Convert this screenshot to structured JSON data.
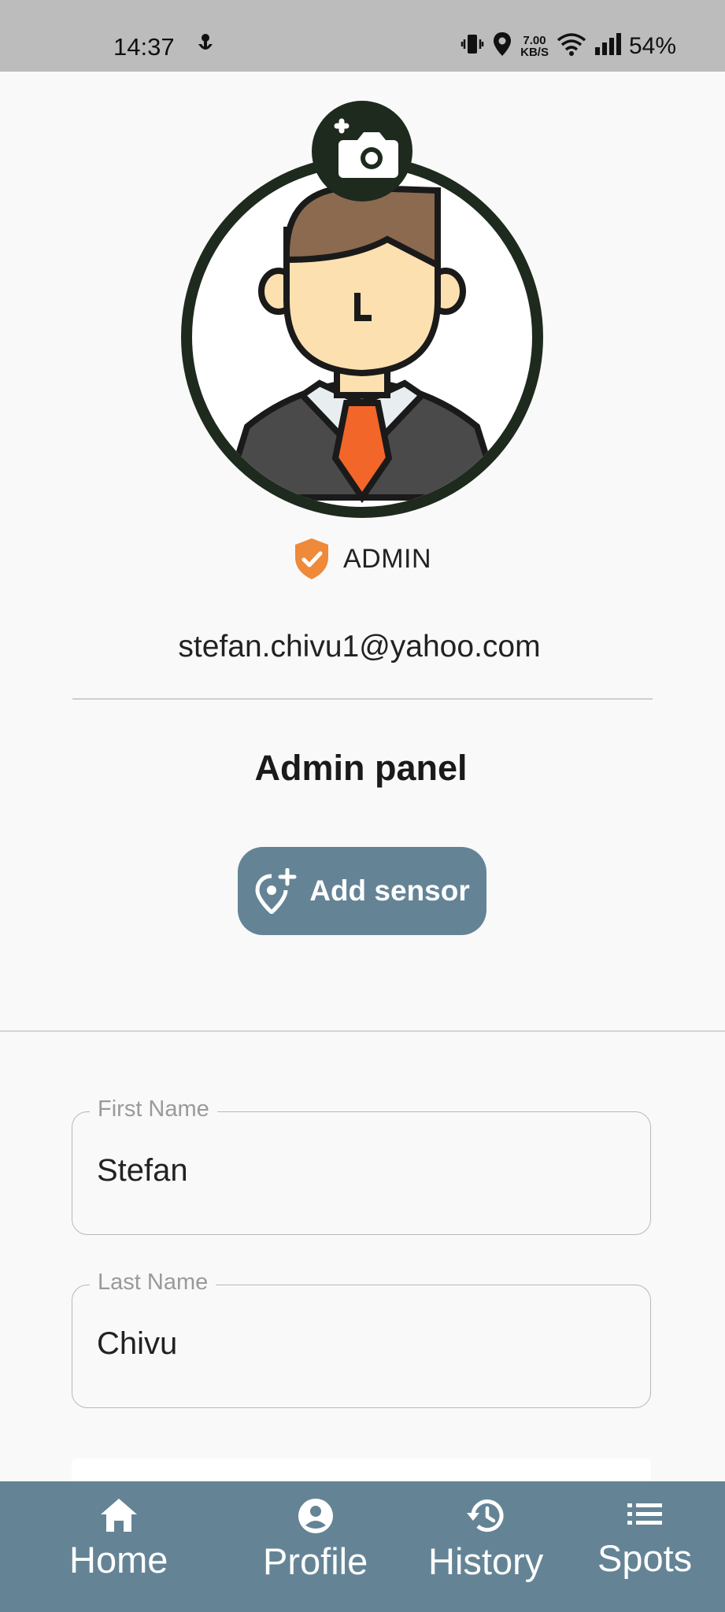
{
  "status_bar": {
    "time": "14:37",
    "speed_value": "7.00",
    "speed_unit": "KB/S",
    "battery": "54%"
  },
  "profile": {
    "role_badge": "ADMIN",
    "email": "stefan.chivu1@yahoo.com"
  },
  "admin_panel": {
    "title": "Admin panel",
    "add_sensor_label": "Add sensor"
  },
  "form": {
    "first_name": {
      "label": "First Name",
      "value": "Stefan"
    },
    "last_name": {
      "label": "Last Name",
      "value": "Chivu"
    }
  },
  "bottom_nav": {
    "items": [
      {
        "label": "Home",
        "icon": "home-icon"
      },
      {
        "label": "Profile",
        "icon": "account-circle-icon"
      },
      {
        "label": "History",
        "icon": "history-icon"
      },
      {
        "label": "Spots",
        "icon": "list-icon"
      }
    ]
  },
  "colors": {
    "accent": "#648496",
    "avatar_ring": "#1e2a1e",
    "badge": "#ee8a3a"
  }
}
